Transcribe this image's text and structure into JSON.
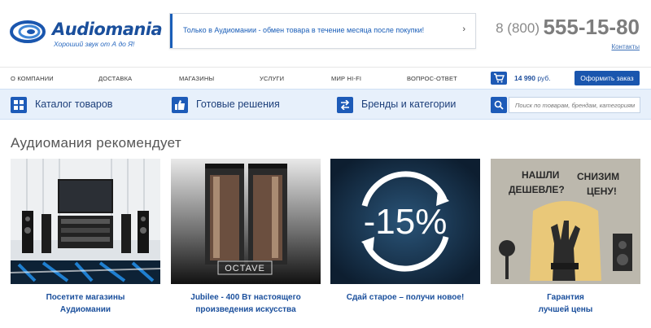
{
  "header": {
    "logo_text": "Audiomania",
    "logo_tagline": "Хороший звук от А до Я!",
    "promo_text": "Только в Аудиомании - обмен товара в течение месяца после покупки!",
    "phone_prefix": "8 (800)",
    "phone_number": "555-15-80",
    "contacts_label": "Контакты"
  },
  "nav": {
    "items": [
      "О КОМПАНИИ",
      "ДОСТАВКА",
      "МАГАЗИНЫ",
      "УСЛУГИ",
      "МИР HI-FI",
      "ВОПРОС-ОТВЕТ"
    ],
    "cart_amount": "14 990",
    "cart_currency": "руб.",
    "order_button": "Оформить заказ"
  },
  "catalog_bar": {
    "catalog": "Каталог товаров",
    "solutions": "Готовые решения",
    "brands": "Бренды и категории",
    "search_placeholder": "Поиск по товарам, брендам, категориям"
  },
  "section": {
    "title": "Аудиомания рекомендует"
  },
  "cards": [
    {
      "line1": "Посетите магазины",
      "line2": "Аудиомании"
    },
    {
      "line1": "Jubilee - 400 Вт настоящего",
      "line2": "произведения искусства",
      "image_label": "OCTAVE"
    },
    {
      "line1": "Сдай старое – получи новое!",
      "line2": "",
      "image_label": "-15%"
    },
    {
      "line1": "Гарантия",
      "line2": "лучшей цены",
      "image_label_1": "НАШЛИ",
      "image_label_2": "ДЕШЕВЛЕ?",
      "image_label_3": "СНИЗИМ",
      "image_label_4": "ЦЕНУ!"
    }
  ],
  "colors": {
    "brand_blue": "#1a56ae",
    "catbar_bg": "#e7f0fb",
    "phone_gray": "#7d7d7d"
  },
  "icons": {
    "cart": "cart-icon",
    "catalog": "grid-icon",
    "solutions": "thumbs-up-icon",
    "brands": "swap-icon",
    "search": "search-icon",
    "promo_arrow": "chevron-right-icon"
  }
}
